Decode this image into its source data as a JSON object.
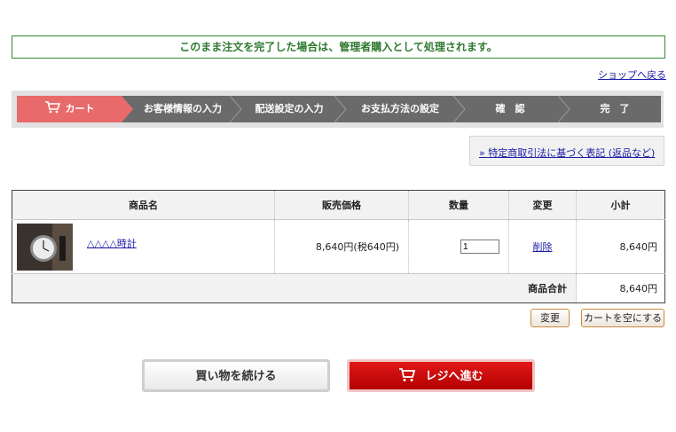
{
  "notice": "このまま注文を完了した場合は、管理者購入として処理されます。",
  "back_link": "ショップへ戻る",
  "steps": [
    "カート",
    "お客様情報の入力",
    "配送設定の入力",
    "お支払方法の設定",
    "確　認",
    "完　了"
  ],
  "legal_link": "» 特定商取引法に基づく表記 (返品など)",
  "table": {
    "headers": [
      "商品名",
      "販売価格",
      "数量",
      "変更",
      "小計"
    ],
    "rows": [
      {
        "name": "△△△△時計",
        "price": "8,640円(税640円)",
        "qty": "1",
        "action": "削除",
        "subtotal": "8,640円"
      }
    ],
    "total_label": "商品合計",
    "total_value": "8,640円"
  },
  "buttons": {
    "update": "変更",
    "empty": "カートを空にする",
    "continue": "買い物を続ける",
    "checkout": "レジへ進む"
  },
  "icons": {
    "cart": "cart-icon",
    "checkout_cart": "cart-icon"
  },
  "colors": {
    "active_step": "#e96a6a",
    "inactive_step": "#6a6a6a",
    "checkout": "#c80a0a",
    "notice": "#2f7a2f"
  }
}
